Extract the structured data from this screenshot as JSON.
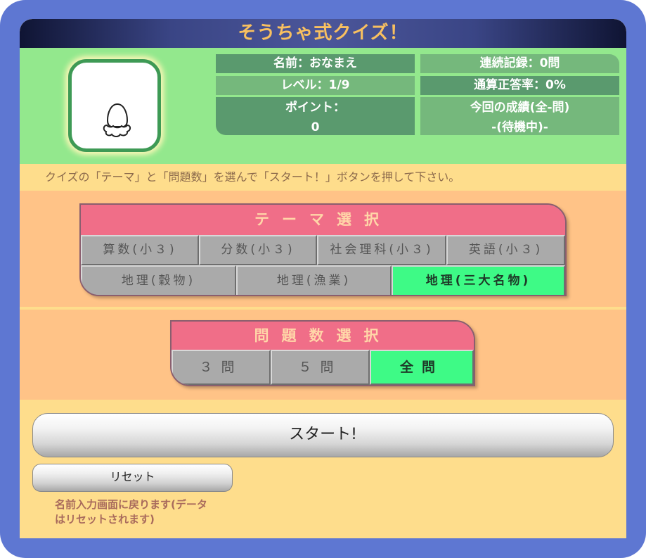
{
  "app": {
    "title": "そうちゃ式クイズ！"
  },
  "avatar": {
    "icon": "egg-icon"
  },
  "stats": {
    "name": "名前：おなまえ",
    "streak": "連続記録：0問",
    "level": "レベル：1/9",
    "accuracy": "通算正答率：0%",
    "points_label": "ポイント：",
    "points_value": "0",
    "result_label": "今回の成績(全-問)",
    "result_value": "-(待機中)-"
  },
  "instruction": "クイズの「テーマ」と「問題数」を選んで「スタート！」ボタンを押して下さい。",
  "theme": {
    "heading": "テーマ選択",
    "row1": [
      "算数(小３)",
      "分数(小３)",
      "社会理科(小３)",
      "英語(小３)"
    ],
    "row2": [
      "地理(穀物)",
      "地理(漁業)",
      "地理(三大名物)"
    ],
    "selected": "地理(三大名物)"
  },
  "count": {
    "heading": "問題数選択",
    "options": [
      "３問",
      "５問",
      "全問"
    ],
    "selected": "全問"
  },
  "buttons": {
    "start": "スタート!",
    "reset": "リセット",
    "reset_note": "名前入力画面に戻ります(データはリセットされます)"
  },
  "colors": {
    "frame": "#5e77d2",
    "status_bg": "#93e88d",
    "panel_head": "#f06e88",
    "selected": "#3efa86",
    "section": "#ffc387",
    "base": "#fedd8c"
  }
}
